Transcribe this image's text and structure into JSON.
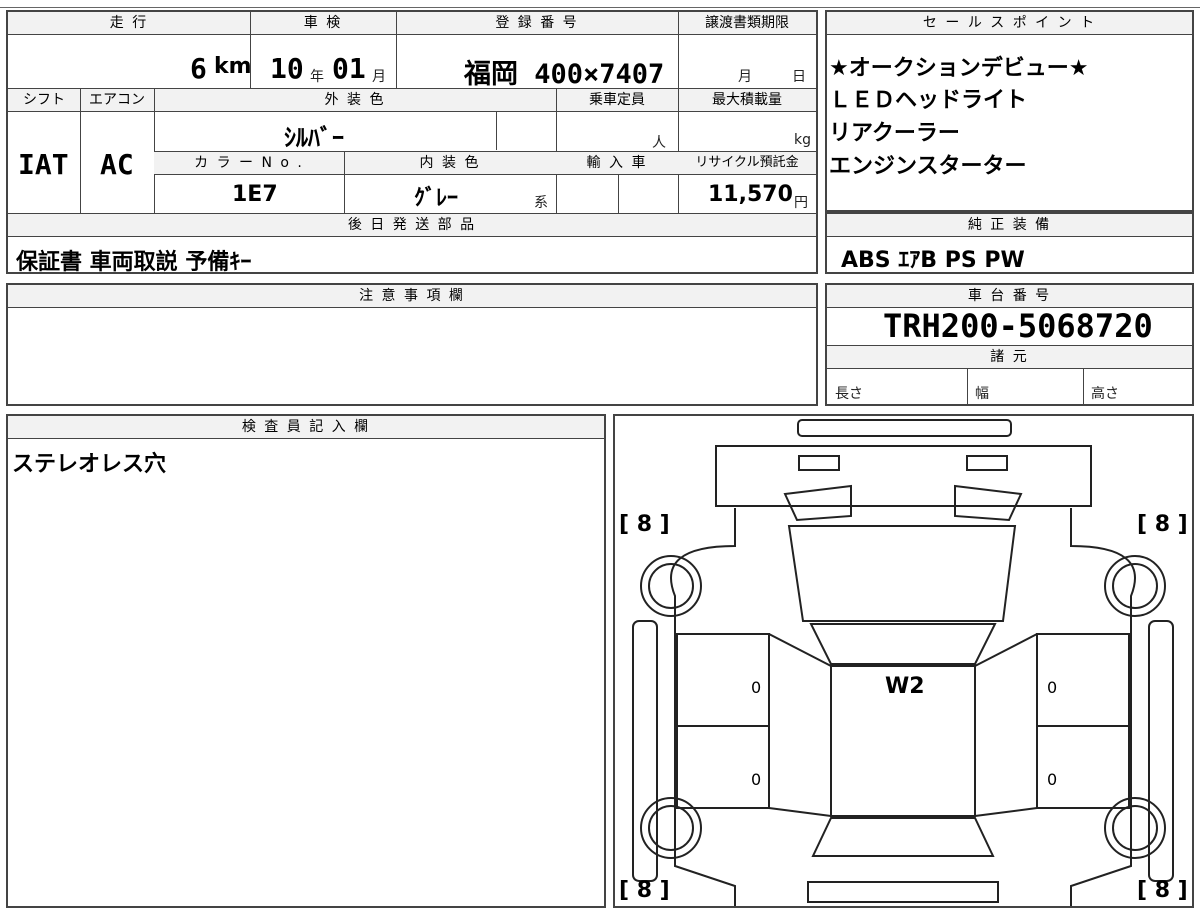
{
  "summary": {
    "mileage_label": "走 行",
    "mileage_value": "6",
    "mileage_unit": "km",
    "inspection_label": "車 検",
    "inspection_year": "10",
    "inspection_year_unit": "年",
    "inspection_month": "01",
    "inspection_month_unit": "月",
    "registration_label": "登 録 番 号",
    "registration_value": "福岡 400×7407",
    "transfer_label": "譲渡書類期限",
    "transfer_month_unit": "月",
    "transfer_day_unit": "日",
    "shift_label": "シフト",
    "shift_value": "IAT",
    "ac_label": "エアコン",
    "ac_value": "AC",
    "exterior_color_label": "外 装 色",
    "exterior_color_value": "ｼﾙﾊﾞｰ",
    "capacity_label": "乗車定員",
    "capacity_unit": "人",
    "max_load_label": "最大積載量",
    "max_load_unit": "kg",
    "color_no_label": "カ ラ ー N o .",
    "color_no_value": "1E7",
    "interior_color_label": "内 装 色",
    "interior_color_value": "ｸﾞﾚｰ",
    "interior_suffix": "系",
    "import_label": "輸 入 車",
    "recycle_label": "リサイクル預託金",
    "recycle_value": "11,570",
    "recycle_unit": "円"
  },
  "later_parts": {
    "label": "後 日 発 送 部 品",
    "value": "保証書 車両取説 予備ｷｰ"
  },
  "sales_points": {
    "label": "セ ー ル ス ポ イ ン ト",
    "items": [
      "★オークションデビュー★",
      "ＬＥＤヘッドライト",
      "リアクーラー",
      "エンジンスターター"
    ]
  },
  "standard_equipment": {
    "label": "純 正 装 備",
    "value": "ABS ｴｱB PS PW"
  },
  "notes": {
    "label": "注 意 事 項 欄"
  },
  "chassis": {
    "label": "車 台 番 号",
    "value": "TRH200-5068720"
  },
  "specs": {
    "label": "諸 元",
    "length": "長さ",
    "width": "幅",
    "height": "高さ"
  },
  "inspector": {
    "label": "検 査 員 記 入 欄",
    "value": "ステレオレス穴"
  },
  "diagram": {
    "corner_fl": "[ 8 ]",
    "corner_fr": "[ 8 ]",
    "corner_rl": "[ 8 ]",
    "corner_rr": "[ 8 ]",
    "door_left_front": "0",
    "door_left_rear": "0",
    "door_right_front": "0",
    "door_right_rear": "0",
    "roof_mark": "W2"
  }
}
